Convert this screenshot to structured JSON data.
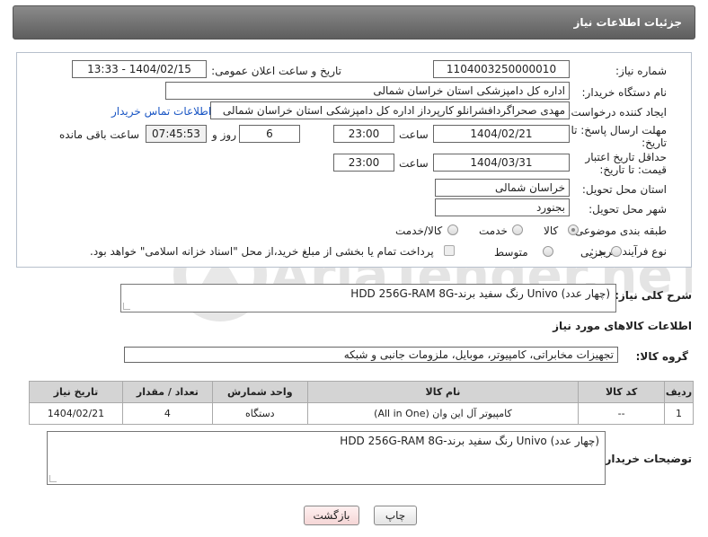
{
  "header": {
    "title": "جزئیات اطلاعات نیاز"
  },
  "form": {
    "need_number_label": "شماره نیاز:",
    "need_number": "1104003250000010",
    "announce_label": "تاریخ و ساعت اعلان عمومی:",
    "announce_value": "1404/02/15 - 13:33",
    "buyer_label": "نام دستگاه خریدار:",
    "buyer_value": "اداره کل دامپزشکی استان خراسان شمالی",
    "creator_label": "ایجاد کننده درخواست:",
    "creator_value": "مهدی صحراگردافشرانلو کارپرداز اداره کل دامپزشکی استان خراسان شمالی",
    "contact_link": "اطلاعات تماس خریدار",
    "deadline_label": "مهلت ارسال پاسخ: تا تاریخ:",
    "deadline_date": "1404/02/21",
    "time_label": "ساعت",
    "deadline_time": "23:00",
    "days_value": "6",
    "days_label": "روز و",
    "remaining_time": "07:45:53",
    "remaining_label": "ساعت باقی مانده",
    "price_validity_label": "حداقل تاریخ اعتبار قیمت: تا تاریخ:",
    "price_date": "1404/03/31",
    "price_time": "23:00",
    "province_label": "استان محل تحویل:",
    "province_value": "خراسان شمالی",
    "city_label": "شهر محل تحویل:",
    "city_value": "بجنورد",
    "category_label": "طبقه بندی موضوعی:",
    "category_options": [
      "کالا",
      "خدمت",
      "کالا/خدمت"
    ],
    "process_label": "نوع فرآیند خرید :",
    "process_options": [
      "جزیی",
      "متوسط"
    ],
    "payment_note": "پرداخت تمام یا بخشی از مبلغ خرید،از محل \"اسناد خزانه اسلامی\" خواهد بود."
  },
  "description": {
    "label": "شرح کلی نیاز:",
    "value": "HDD 256G-RAM 8G-رنگ سفید  برند Univo  (چهار عدد)"
  },
  "goods_info_title": "اطلاعات کالاهای مورد نیاز",
  "goods_group": {
    "label": "گروه کالا:",
    "value": "تجهیزات مخابراتی، کامپیوتر، موبایل، ملزومات جانبی و شبکه"
  },
  "table": {
    "headers": [
      "ردیف",
      "کد کالا",
      "نام کالا",
      "واحد شمارش",
      "تعداد / مقدار",
      "تاریخ نیاز"
    ],
    "rows": [
      [
        "1",
        "--",
        "کامپیوتر آل این وان (All in One)",
        "دستگاه",
        "4",
        "1404/02/21"
      ]
    ]
  },
  "buyer_notes": {
    "label": "توضیحات خریدار:",
    "value": "HDD 256G-RAM 8G-رنگ سفید  برند Univo  (چهار عدد)"
  },
  "buttons": {
    "print": "چاپ",
    "back": "بازگشت"
  },
  "watermark": {
    "text": "AriaTender.neT"
  }
}
